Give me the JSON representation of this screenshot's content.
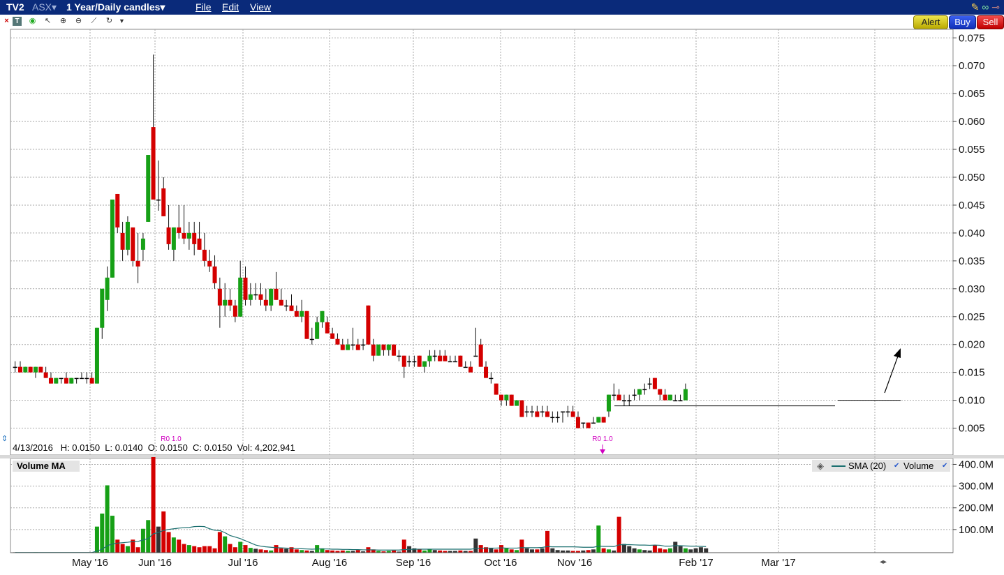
{
  "header": {
    "symbol": "TV2",
    "exchange": "ASX",
    "period": "1 Year/Daily candles",
    "menu": [
      "File",
      "Edit",
      "View"
    ]
  },
  "toolbar": {
    "alert_label": "Alert",
    "buy_label": "Buy",
    "sell_label": "Sell"
  },
  "info": {
    "date": "4/13/2016",
    "text": "H: 0.0150  L: 0.0140  O: 0.0150  C: 0.0150  Vol: 4,202,941"
  },
  "volume_panel": {
    "title": "Volume MA",
    "legend_sma": "SMA (20)",
    "legend_volume": "Volume"
  },
  "markers": [
    {
      "label": "R0 1.0"
    },
    {
      "label": "R0 1.0"
    }
  ],
  "colors": {
    "up": "#16a016",
    "down": "#d40000",
    "neutral": "#000000",
    "grey_volume": "#333333",
    "sma": "#1a6f6f",
    "titlebar": "#0a2a7a"
  },
  "chart_data": [
    {
      "type": "candlestick",
      "interval": "daily",
      "period": "1 Year",
      "x_tick_labels": [
        "May '16",
        "Jun '16",
        "Jul '16",
        "Aug '16",
        "Sep '16",
        "Oct '16",
        "Nov '16",
        "Feb '17",
        "Mar '17"
      ],
      "y_tick_labels": [
        "0.005",
        "0.010",
        "0.015",
        "0.020",
        "0.025",
        "0.030",
        "0.035",
        "0.040",
        "0.045",
        "0.050",
        "0.055",
        "0.060",
        "0.065",
        "0.070",
        "0.075"
      ],
      "ylim": [
        0.0,
        0.077
      ],
      "grid": true,
      "reference_line": 0.01,
      "legend": "none",
      "candles": [
        [
          0.016,
          0.017,
          0.015,
          0.016
        ],
        [
          0.016,
          0.017,
          0.015,
          0.015
        ],
        [
          0.015,
          0.016,
          0.015,
          0.016
        ],
        [
          0.016,
          0.016,
          0.015,
          0.015
        ],
        [
          0.015,
          0.016,
          0.014,
          0.016
        ],
        [
          0.016,
          0.016,
          0.015,
          0.015
        ],
        [
          0.015,
          0.016,
          0.014,
          0.014
        ],
        [
          0.014,
          0.015,
          0.013,
          0.013
        ],
        [
          0.013,
          0.014,
          0.013,
          0.014
        ],
        [
          0.014,
          0.014,
          0.013,
          0.014
        ],
        [
          0.014,
          0.015,
          0.013,
          0.013
        ],
        [
          0.013,
          0.014,
          0.013,
          0.014
        ],
        [
          0.014,
          0.014,
          0.013,
          0.014
        ],
        [
          0.014,
          0.015,
          0.014,
          0.014
        ],
        [
          0.014,
          0.015,
          0.013,
          0.014
        ],
        [
          0.014,
          0.015,
          0.013,
          0.013
        ],
        [
          0.013,
          0.023,
          0.013,
          0.023
        ],
        [
          0.023,
          0.03,
          0.021,
          0.03
        ],
        [
          0.028,
          0.034,
          0.026,
          0.032
        ],
        [
          0.032,
          0.046,
          0.032,
          0.046
        ],
        [
          0.047,
          0.047,
          0.04,
          0.041
        ],
        [
          0.04,
          0.042,
          0.035,
          0.037
        ],
        [
          0.037,
          0.043,
          0.036,
          0.042
        ],
        [
          0.041,
          0.041,
          0.034,
          0.035
        ],
        [
          0.035,
          0.04,
          0.031,
          0.034
        ],
        [
          0.037,
          0.04,
          0.035,
          0.039
        ],
        [
          0.042,
          0.054,
          0.042,
          0.054
        ],
        [
          0.059,
          0.072,
          0.049,
          0.046
        ],
        [
          0.046,
          0.053,
          0.044,
          0.046
        ],
        [
          0.048,
          0.05,
          0.043,
          0.043
        ],
        [
          0.041,
          0.045,
          0.037,
          0.038
        ],
        [
          0.037,
          0.041,
          0.035,
          0.041
        ],
        [
          0.041,
          0.045,
          0.039,
          0.04
        ],
        [
          0.04,
          0.045,
          0.038,
          0.039
        ],
        [
          0.039,
          0.042,
          0.037,
          0.04
        ],
        [
          0.04,
          0.042,
          0.036,
          0.038
        ],
        [
          0.039,
          0.042,
          0.037,
          0.037
        ],
        [
          0.037,
          0.04,
          0.034,
          0.035
        ],
        [
          0.035,
          0.037,
          0.033,
          0.034
        ],
        [
          0.034,
          0.036,
          0.03,
          0.031
        ],
        [
          0.03,
          0.032,
          0.023,
          0.027
        ],
        [
          0.027,
          0.031,
          0.025,
          0.028
        ],
        [
          0.028,
          0.03,
          0.026,
          0.027
        ],
        [
          0.027,
          0.028,
          0.024,
          0.025
        ],
        [
          0.025,
          0.035,
          0.025,
          0.032
        ],
        [
          0.032,
          0.034,
          0.027,
          0.028
        ],
        [
          0.028,
          0.031,
          0.027,
          0.029
        ],
        [
          0.029,
          0.031,
          0.028,
          0.029
        ],
        [
          0.029,
          0.031,
          0.027,
          0.028
        ],
        [
          0.028,
          0.03,
          0.026,
          0.027
        ],
        [
          0.027,
          0.03,
          0.026,
          0.03
        ],
        [
          0.03,
          0.033,
          0.028,
          0.028
        ],
        [
          0.028,
          0.03,
          0.027,
          0.027
        ],
        [
          0.027,
          0.028,
          0.026,
          0.027
        ],
        [
          0.027,
          0.029,
          0.026,
          0.026
        ],
        [
          0.026,
          0.027,
          0.025,
          0.025
        ],
        [
          0.025,
          0.028,
          0.024,
          0.026
        ],
        [
          0.026,
          0.026,
          0.021,
          0.021
        ],
        [
          0.021,
          0.023,
          0.02,
          0.021
        ],
        [
          0.021,
          0.025,
          0.021,
          0.024
        ],
        [
          0.024,
          0.026,
          0.023,
          0.026
        ],
        [
          0.024,
          0.025,
          0.022,
          0.022
        ],
        [
          0.022,
          0.023,
          0.021,
          0.021
        ],
        [
          0.021,
          0.022,
          0.02,
          0.02
        ],
        [
          0.02,
          0.021,
          0.019,
          0.019
        ],
        [
          0.019,
          0.021,
          0.019,
          0.02
        ],
        [
          0.02,
          0.023,
          0.019,
          0.02
        ],
        [
          0.02,
          0.021,
          0.019,
          0.019
        ],
        [
          0.02,
          0.021,
          0.019,
          0.02
        ],
        [
          0.027,
          0.027,
          0.02,
          0.02
        ],
        [
          0.02,
          0.021,
          0.017,
          0.018
        ],
        [
          0.018,
          0.02,
          0.018,
          0.02
        ],
        [
          0.02,
          0.02,
          0.018,
          0.019
        ],
        [
          0.019,
          0.02,
          0.018,
          0.02
        ],
        [
          0.02,
          0.02,
          0.018,
          0.018
        ],
        [
          0.018,
          0.019,
          0.017,
          0.018
        ],
        [
          0.018,
          0.018,
          0.014,
          0.016
        ],
        [
          0.017,
          0.018,
          0.016,
          0.017
        ],
        [
          0.017,
          0.018,
          0.016,
          0.017
        ],
        [
          0.018,
          0.018,
          0.016,
          0.016
        ],
        [
          0.016,
          0.017,
          0.015,
          0.017
        ],
        [
          0.017,
          0.019,
          0.016,
          0.018
        ],
        [
          0.018,
          0.019,
          0.017,
          0.018
        ],
        [
          0.018,
          0.019,
          0.017,
          0.017
        ],
        [
          0.018,
          0.019,
          0.017,
          0.017
        ],
        [
          0.017,
          0.018,
          0.017,
          0.017
        ],
        [
          0.017,
          0.018,
          0.017,
          0.017
        ],
        [
          0.018,
          0.018,
          0.016,
          0.016
        ],
        [
          0.016,
          0.017,
          0.016,
          0.016
        ],
        [
          0.016,
          0.017,
          0.015,
          0.015
        ],
        [
          0.018,
          0.023,
          0.018,
          0.018
        ],
        [
          0.02,
          0.021,
          0.016,
          0.016
        ],
        [
          0.016,
          0.017,
          0.014,
          0.014
        ],
        [
          0.014,
          0.015,
          0.013,
          0.014
        ],
        [
          0.013,
          0.013,
          0.011,
          0.011
        ],
        [
          0.011,
          0.011,
          0.009,
          0.01
        ],
        [
          0.01,
          0.011,
          0.009,
          0.011
        ],
        [
          0.011,
          0.011,
          0.009,
          0.009
        ],
        [
          0.009,
          0.01,
          0.009,
          0.01
        ],
        [
          0.01,
          0.01,
          0.007,
          0.007
        ],
        [
          0.008,
          0.009,
          0.007,
          0.008
        ],
        [
          0.008,
          0.009,
          0.007,
          0.008
        ],
        [
          0.008,
          0.009,
          0.007,
          0.007
        ],
        [
          0.008,
          0.009,
          0.007,
          0.008
        ],
        [
          0.008,
          0.009,
          0.007,
          0.007
        ],
        [
          0.007,
          0.008,
          0.006,
          0.007
        ],
        [
          0.007,
          0.008,
          0.006,
          0.007
        ],
        [
          0.008,
          0.008,
          0.006,
          0.008
        ],
        [
          0.008,
          0.009,
          0.007,
          0.008
        ],
        [
          0.008,
          0.009,
          0.007,
          0.007
        ],
        [
          0.007,
          0.008,
          0.005,
          0.005
        ],
        [
          0.006,
          0.006,
          0.005,
          0.006
        ],
        [
          0.006,
          0.006,
          0.005,
          0.005
        ],
        [
          0.006,
          0.007,
          0.006,
          0.006
        ],
        [
          0.006,
          0.007,
          0.006,
          0.007
        ],
        [
          0.007,
          0.007,
          0.006,
          0.006
        ],
        [
          0.008,
          0.011,
          0.007,
          0.011
        ],
        [
          0.011,
          0.013,
          0.01,
          0.011
        ],
        [
          0.011,
          0.012,
          0.01,
          0.01
        ],
        [
          0.01,
          0.011,
          0.009,
          0.01
        ],
        [
          0.01,
          0.011,
          0.009,
          0.01
        ],
        [
          0.011,
          0.012,
          0.01,
          0.011
        ],
        [
          0.011,
          0.012,
          0.01,
          0.012
        ],
        [
          0.012,
          0.013,
          0.011,
          0.012
        ],
        [
          0.013,
          0.014,
          0.012,
          0.013
        ],
        [
          0.014,
          0.014,
          0.012,
          0.012
        ],
        [
          0.012,
          0.012,
          0.01,
          0.011
        ],
        [
          0.011,
          0.012,
          0.01,
          0.01
        ],
        [
          0.01,
          0.011,
          0.01,
          0.011
        ],
        [
          0.01,
          0.011,
          0.01,
          0.01
        ],
        [
          0.01,
          0.011,
          0.01,
          0.01
        ],
        [
          0.01,
          0.013,
          0.01,
          0.012
        ]
      ]
    },
    {
      "type": "bar",
      "title": "Volume MA",
      "y_tick_labels": [
        "100.0M",
        "200.0M",
        "300.0M",
        "400.0M"
      ],
      "ylim": [
        0,
        420000000
      ],
      "series_legend": [
        "SMA (20)",
        "Volume"
      ],
      "volume_millions": [
        2,
        1,
        1,
        1,
        2,
        1,
        1,
        1,
        1,
        1,
        1,
        1,
        1,
        1,
        1,
        1,
        120,
        180,
        310,
        170,
        60,
        40,
        30,
        60,
        25,
        110,
        150,
        440,
        120,
        190,
        95,
        70,
        60,
        40,
        35,
        30,
        25,
        30,
        30,
        20,
        95,
        75,
        40,
        25,
        50,
        35,
        22,
        18,
        15,
        12,
        10,
        35,
        20,
        18,
        25,
        15,
        12,
        10,
        8,
        35,
        20,
        12,
        10,
        8,
        10,
        8,
        8,
        12,
        6,
        25,
        15,
        8,
        6,
        8,
        10,
        5,
        60,
        30,
        20,
        15,
        10,
        15,
        12,
        10,
        8,
        8,
        8,
        10,
        8,
        8,
        65,
        35,
        25,
        20,
        15,
        35,
        20,
        15,
        12,
        60,
        20,
        15,
        15,
        20,
        100,
        20,
        12,
        10,
        10,
        8,
        8,
        10,
        12,
        15,
        125,
        20,
        15,
        10,
        165,
        40,
        30,
        20,
        15,
        12,
        10,
        35,
        20,
        15,
        20,
        50,
        30,
        20,
        15,
        20,
        25,
        20
      ],
      "volume_sma_20_millions": [
        1,
        1,
        1,
        1,
        1,
        1,
        1,
        1,
        1,
        1,
        1,
        1,
        1,
        1,
        1,
        1,
        7,
        16,
        32,
        40,
        44,
        46,
        48,
        51,
        52,
        58,
        65,
        87,
        93,
        102,
        107,
        110,
        113,
        115,
        116,
        120,
        121,
        120,
        110,
        103,
        102,
        92,
        79,
        72,
        65,
        55,
        45,
        35,
        30,
        27,
        25,
        23,
        22,
        21,
        20,
        19,
        18,
        17,
        16,
        17,
        17,
        17,
        16,
        16,
        15,
        15,
        14,
        14,
        13,
        13,
        13,
        12,
        12,
        12,
        12,
        12,
        14,
        15,
        16,
        16,
        16,
        16,
        16,
        16,
        16,
        16,
        16,
        16,
        16,
        16,
        19,
        20,
        21,
        21,
        21,
        22,
        21,
        21,
        21,
        23,
        23,
        23,
        23,
        24,
        28,
        27,
        27,
        27,
        27,
        27,
        26,
        25,
        25,
        25,
        30,
        29,
        29,
        28,
        36,
        37,
        37,
        36,
        35,
        35,
        34,
        35,
        34,
        30,
        30,
        32,
        32,
        31,
        30,
        30,
        29,
        28
      ],
      "volume_colors": "up=green, down=red, unchanged=dark grey"
    }
  ]
}
